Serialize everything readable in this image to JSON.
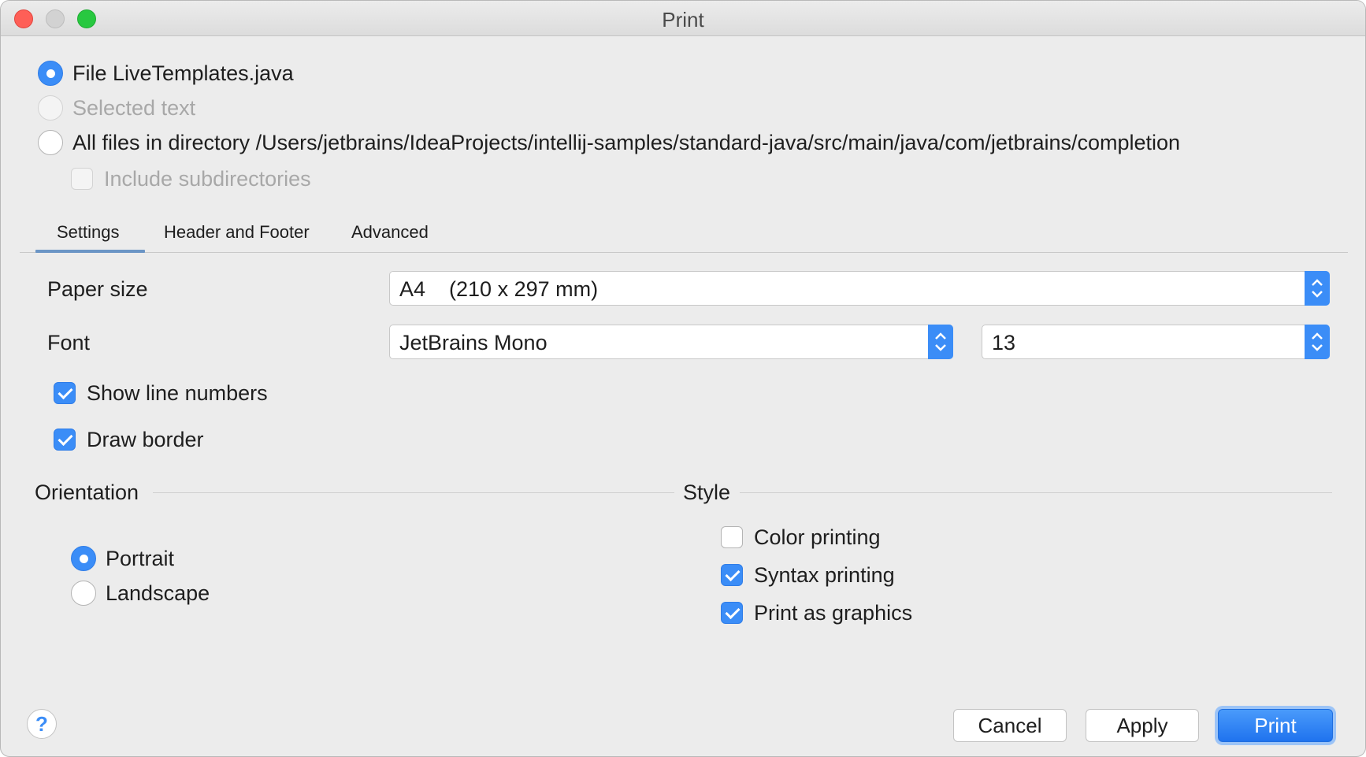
{
  "window": {
    "title": "Print"
  },
  "scope": {
    "file_label": "File LiveTemplates.java",
    "file_selected": true,
    "selected_text_label": "Selected text",
    "selected_text_enabled": false,
    "all_files_label": "All files in directory /Users/jetbrains/IdeaProjects/intellij-samples/standard-java/src/main/java/com/jetbrains/completion",
    "include_subdirs_label": "Include subdirectories",
    "include_subdirs_enabled": false
  },
  "tabs": [
    {
      "label": "Settings",
      "active": true
    },
    {
      "label": "Header and Footer",
      "active": false
    },
    {
      "label": "Advanced",
      "active": false
    }
  ],
  "settings": {
    "paper_size_label": "Paper size",
    "paper_size_value": "A4    (210 x 297 mm)",
    "font_label": "Font",
    "font_value": "JetBrains Mono",
    "font_size_value": "13",
    "show_line_numbers_label": "Show line numbers",
    "show_line_numbers_checked": true,
    "draw_border_label": "Draw border",
    "draw_border_checked": true
  },
  "orientation": {
    "title": "Orientation",
    "portrait_label": "Portrait",
    "landscape_label": "Landscape",
    "selected": "Portrait"
  },
  "style": {
    "title": "Style",
    "color_printing_label": "Color printing",
    "color_printing_checked": false,
    "syntax_printing_label": "Syntax printing",
    "syntax_printing_checked": true,
    "print_as_graphics_label": "Print as graphics",
    "print_as_graphics_checked": true
  },
  "buttons": {
    "help_label": "?",
    "cancel_label": "Cancel",
    "apply_label": "Apply",
    "print_label": "Print"
  },
  "colors": {
    "accent": "#3b8df7",
    "window_bg": "#ececec",
    "primary_button": "#1f73ee"
  },
  "icons": {
    "combo_arrow": "up-down-chevron-icon",
    "help": "question-mark-icon"
  }
}
